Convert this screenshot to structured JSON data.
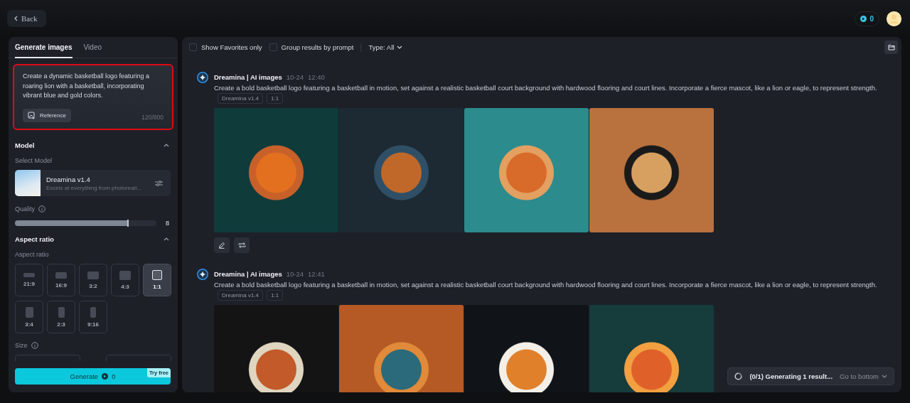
{
  "top_bar": {
    "back_label": "Back",
    "credits": "0"
  },
  "left_panel": {
    "tabs": [
      {
        "label": "Generate images",
        "selected": true
      },
      {
        "label": "Video",
        "selected": false
      }
    ],
    "prompt": {
      "text": "Create a dynamic basketball logo featuring a roaring lion with a basketball, incorporating vibrant blue and gold colors.",
      "highlighted": true,
      "reference_label": "Reference",
      "counter": "120/800"
    },
    "model_section": {
      "title": "Model",
      "expanded": true,
      "select_label": "Select Model",
      "model_name": "Dreamina v1.4",
      "model_description": "Excels at everything from photoreali..."
    },
    "quality": {
      "label": "Quality",
      "level": 0.8,
      "value": "8"
    },
    "aspect_section": {
      "title": "Aspect ratio",
      "expanded": true,
      "label": "Aspect ratio",
      "options": [
        {
          "label": "21:9",
          "selected": false
        },
        {
          "label": "16:9",
          "selected": false
        },
        {
          "label": "3:2",
          "selected": false
        },
        {
          "label": "4:3",
          "selected": false
        },
        {
          "label": "1:1",
          "selected": true
        },
        {
          "label": "3:4",
          "selected": false
        },
        {
          "label": "2:3",
          "selected": false
        },
        {
          "label": "9:16",
          "selected": false
        }
      ]
    },
    "size": {
      "label": "Size"
    },
    "generate": {
      "label": "Generate",
      "cost": "0",
      "badge": "Try free"
    }
  },
  "toolbar": {
    "filters": [
      {
        "label": "Show Favorites only",
        "checked": false
      },
      {
        "label": "Group results by prompt",
        "checked": false
      }
    ],
    "type_filter": "Type: All"
  },
  "results": [
    {
      "source": "Dreamina | AI images",
      "date": "10-24",
      "time": "12:40",
      "prompt": "Create a bold basketball logo featuring a basketball in motion, set against a realistic basketball court background with hardwood flooring and court lines. Incorporate a fierce mascot, like a lion or eagle, to represent strength.",
      "tags": [
        "Dreamina v1.4",
        "1:1"
      ],
      "show_actions": true
    },
    {
      "source": "Dreamina | AI images",
      "date": "10-24",
      "time": "12:41",
      "prompt": "Create a bold basketball logo featuring a basketball in motion, set against a realistic basketball court background with hardwood flooring and court lines. Incorporate a fierce mascot, like a lion or eagle, to represent strength.",
      "tags": [
        "Dreamina v1.4",
        "1:1"
      ],
      "show_actions": false
    }
  ],
  "toast": {
    "progress": "(0/1) Generating 1 result...",
    "link": "Go to bottom"
  }
}
